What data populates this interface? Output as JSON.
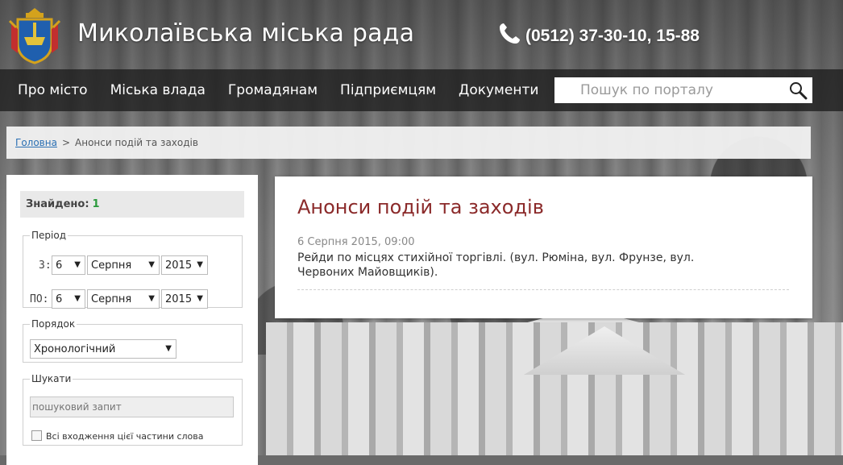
{
  "header": {
    "title": "Миколаївська міська рада",
    "phone": "(0512) 37-30-10, 15-88"
  },
  "nav": {
    "items": [
      "Про місто",
      "Міська влада",
      "Громадянам",
      "Підприємцям",
      "Документи"
    ],
    "search_placeholder": "Пошук по порталу"
  },
  "breadcrumb": {
    "home": "Головна",
    "separator": ">",
    "current": "Анонси подій та заходів"
  },
  "filters": {
    "found_label": "Знайдено:",
    "found_count": "1",
    "period": {
      "legend": "Період",
      "from_label": "З:",
      "to_label": "ПО:",
      "from": {
        "day": "6",
        "month": "Серпня",
        "year": "2015"
      },
      "to": {
        "day": "6",
        "month": "Серпня",
        "year": "2015"
      }
    },
    "order": {
      "legend": "Порядок",
      "value": "Хронологічний"
    },
    "search": {
      "legend": "Шукати",
      "placeholder": "пошуковий запит",
      "checkbox_label": "Всі входження цієї частини слова",
      "checkbox_checked": false
    }
  },
  "main": {
    "title": "Анонси подій та заходів",
    "events": [
      {
        "date": "6 Серпня 2015, 09:00",
        "text": "Рейди по місцях стихійної торгівлі. (вул. Рюміна, вул. Фрунзе, вул. Червоних Майовщиків)."
      }
    ]
  },
  "colors": {
    "title_accent": "#8b2a2a",
    "found_count": "#2b9a3c",
    "link": "#2a6fb3"
  }
}
